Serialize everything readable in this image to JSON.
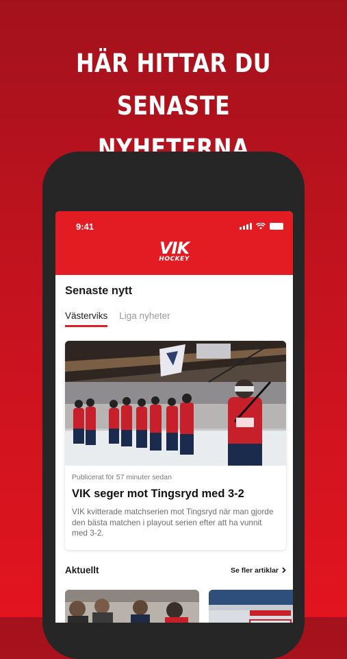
{
  "promo": {
    "line1": "HÄR HITTAR DU SENASTE",
    "line2": "NYHETERNA"
  },
  "status_bar": {
    "time": "9:41"
  },
  "logo": {
    "top": "VIK",
    "bottom": "HOCKEY"
  },
  "news": {
    "title": "Senaste nytt",
    "tabs": [
      {
        "label": "Västerviks",
        "active": true
      },
      {
        "label": "Liga nyheter",
        "active": false
      }
    ],
    "featured": {
      "meta": "Publicerat för 57 minuter sedan",
      "title": "VIK seger mot Tingsryd med 3-2",
      "body": "VIK kvitterade matchserien mot Tingsryd när man gjorde den bästa matchen i playout serien efter att ha vunnit med 3-2."
    }
  },
  "aktuellt": {
    "title": "Aktuellt",
    "link": "Se fler artiklar"
  },
  "colors": {
    "brand_red": "#e31b23",
    "phone_frame": "#262626"
  }
}
